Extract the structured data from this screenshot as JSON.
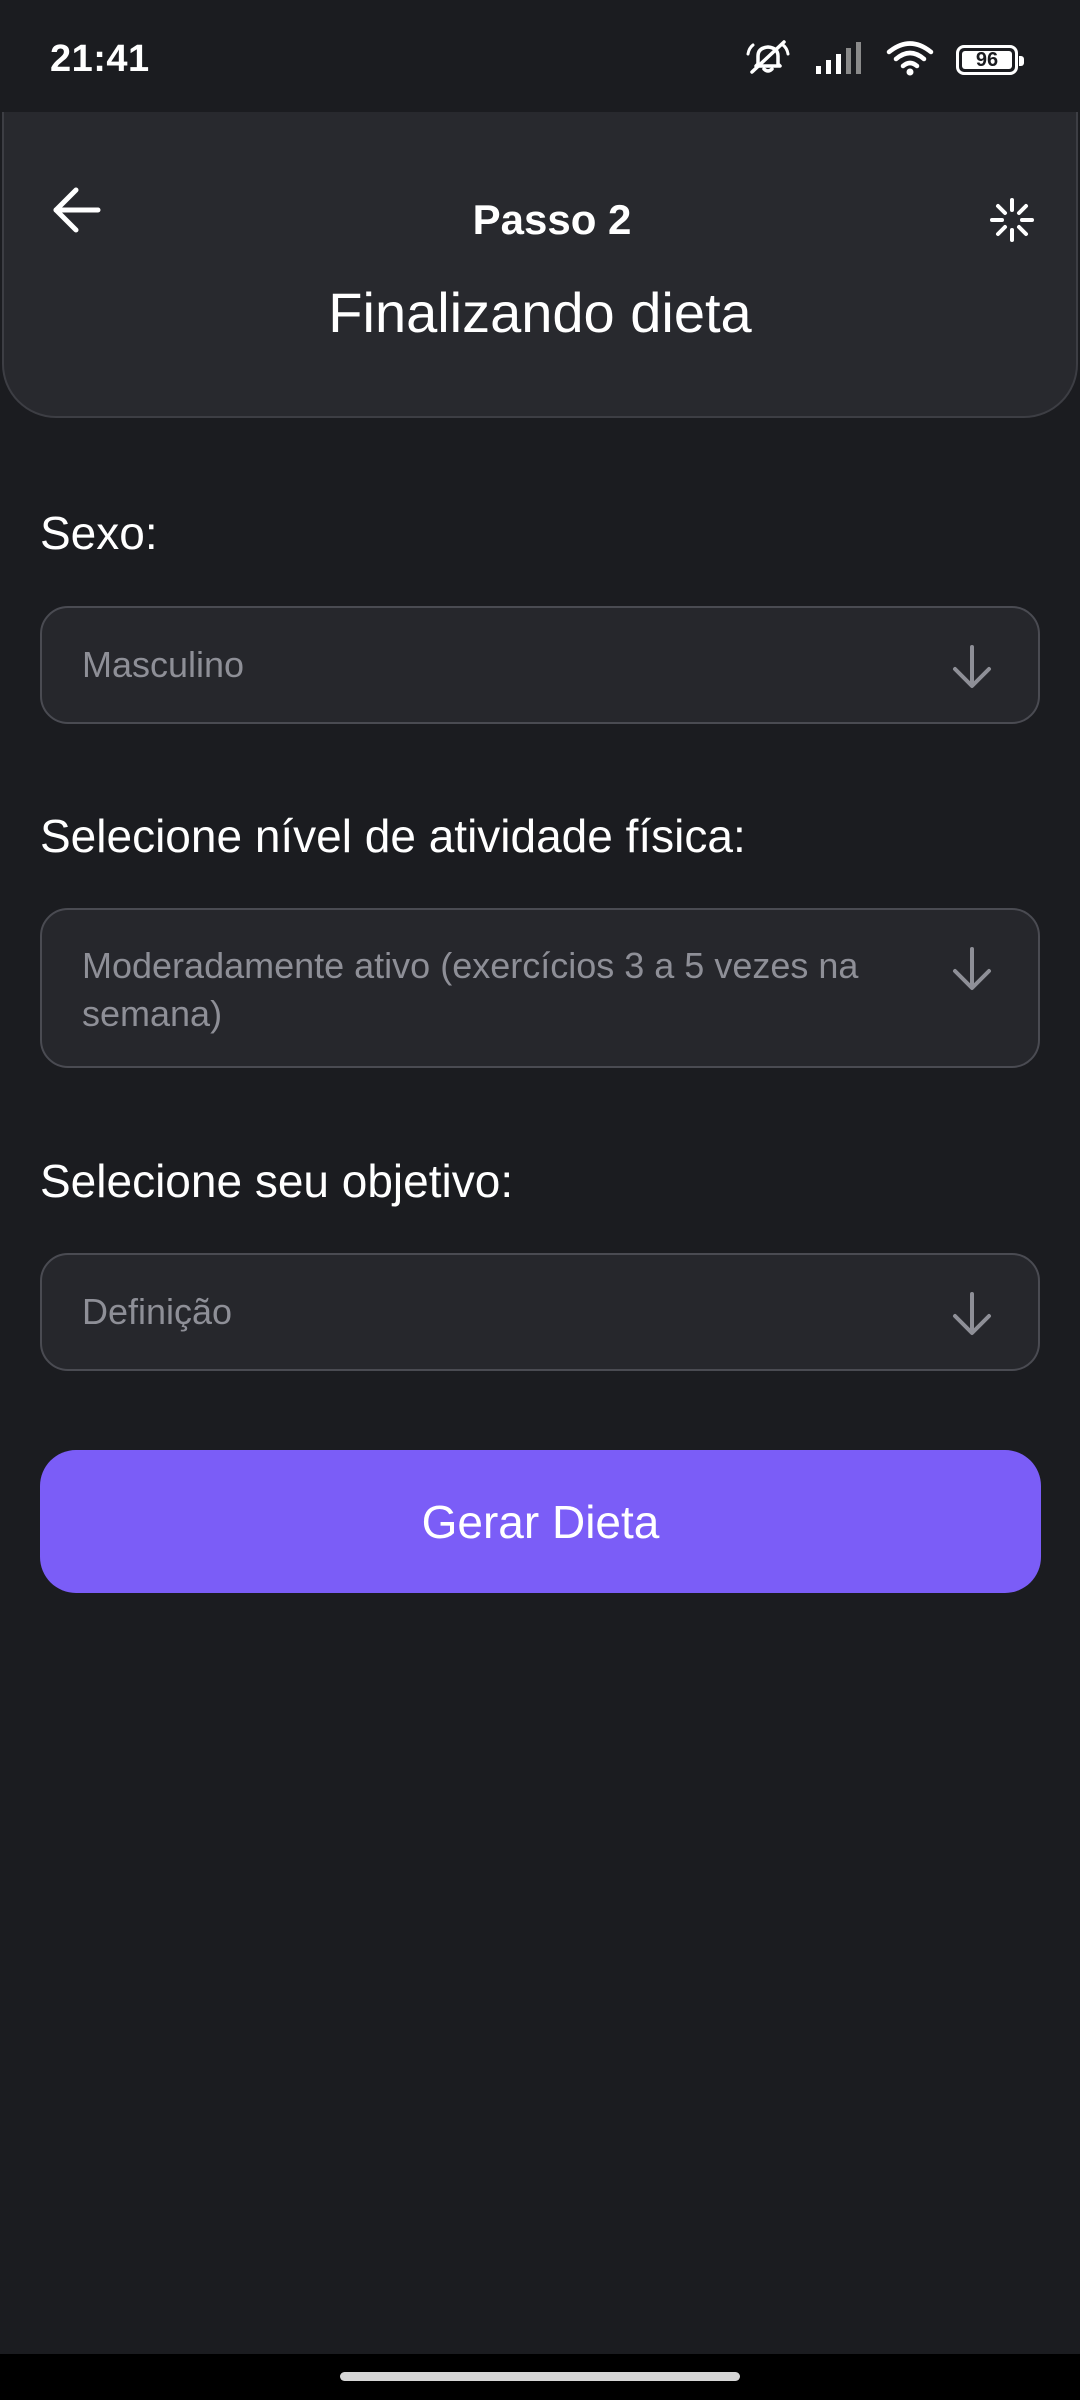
{
  "status_bar": {
    "time": "21:41",
    "battery_level": "96",
    "icons": [
      "mute-icon",
      "signal-icon",
      "wifi-icon",
      "battery-icon"
    ]
  },
  "header": {
    "step": "Passo 2",
    "title": "Finalizando dieta",
    "back_icon": "arrow-left-icon",
    "loading_icon": "spinner-icon"
  },
  "form": {
    "sex": {
      "label": "Sexo:",
      "value": "Masculino"
    },
    "activity": {
      "label": "Selecione nível de atividade física:",
      "value": "Moderadamente ativo (exercícios 3 a 5 vezes na semana)"
    },
    "goal": {
      "label": "Selecione seu objetivo:",
      "value": "Definição"
    },
    "submit_label": "Gerar Dieta"
  },
  "colors": {
    "background": "#1b1c20",
    "card": "#28292e",
    "accent": "#7b5df7",
    "placeholder_text": "#8e8f97"
  }
}
